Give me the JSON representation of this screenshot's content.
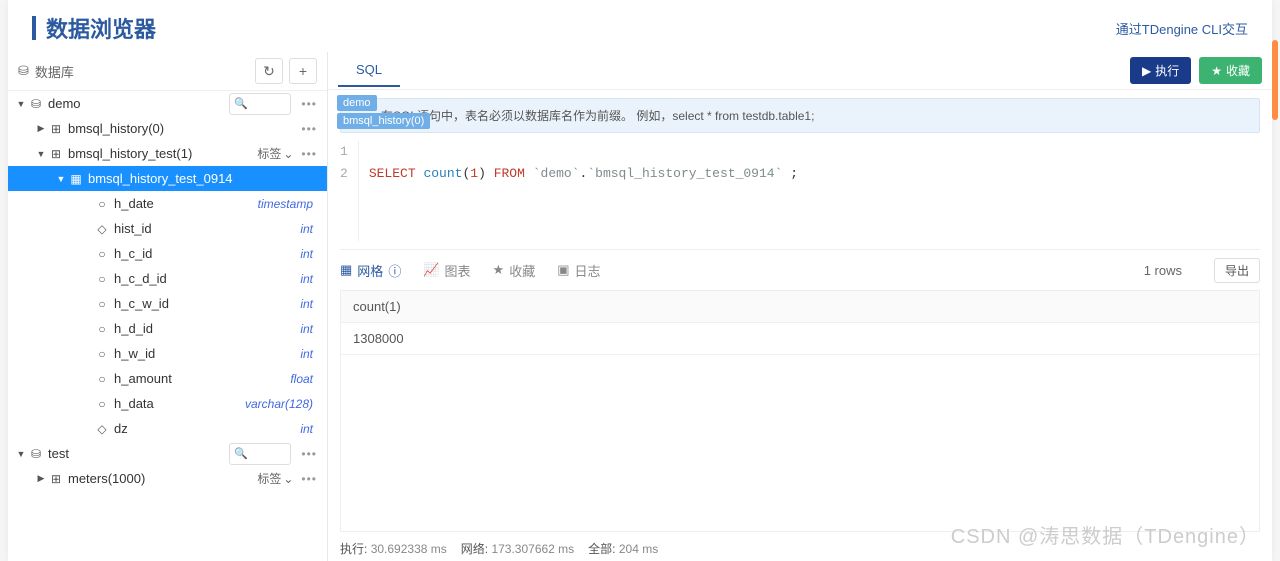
{
  "header": {
    "title": "数据浏览器",
    "cli_link": "通过TDengine CLI交互"
  },
  "sidebar": {
    "label": "数据库",
    "db_demo": {
      "name": "demo"
    },
    "tbl_hist": {
      "name": "bmsql_history(0)"
    },
    "tbl_hist_test": {
      "name": "bmsql_history_test(1)",
      "tag_label": "标签"
    },
    "tbl_hist_0914": {
      "name": "bmsql_history_test_0914"
    },
    "cols": [
      {
        "name": "h_date",
        "type": "timestamp"
      },
      {
        "name": "hist_id",
        "type": "int"
      },
      {
        "name": "h_c_id",
        "type": "int"
      },
      {
        "name": "h_c_d_id",
        "type": "int"
      },
      {
        "name": "h_c_w_id",
        "type": "int"
      },
      {
        "name": "h_d_id",
        "type": "int"
      },
      {
        "name": "h_w_id",
        "type": "int"
      },
      {
        "name": "h_amount",
        "type": "float"
      },
      {
        "name": "h_data",
        "type": "varchar(128)"
      },
      {
        "name": "dz",
        "type": "int"
      }
    ],
    "db_test": {
      "name": "test"
    },
    "tbl_meters": {
      "name": "meters(1000)",
      "tag_label": "标签"
    }
  },
  "main": {
    "tab_sql": "SQL",
    "btn_run": "执行",
    "btn_fav": "收藏",
    "chip1": "demo",
    "chip2": "bmsql_history(0)",
    "hint": "在SQL语句中，表名必须以数据库名作为前缀。 例如，select * from testdb.table1;",
    "sql_line": "SELECT count(1) FROM `demo`.`bmsql_history_test_0914` ;"
  },
  "results": {
    "tab_grid": "网格",
    "tab_chart": "图表",
    "tab_fav": "收藏",
    "tab_log": "日志",
    "rows": "1 rows",
    "export": "导出",
    "col_header": "count(1)",
    "row0": "1308000"
  },
  "status": {
    "exec_k": "执行:",
    "exec_v": "30.692338 ms",
    "net_k": "网络:",
    "net_v": "173.307662 ms",
    "all_k": "全部:",
    "all_v": "204 ms"
  },
  "watermark": "CSDN @涛思数据（TDengine）"
}
